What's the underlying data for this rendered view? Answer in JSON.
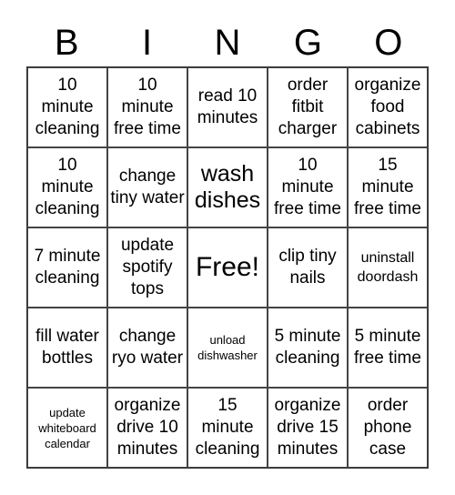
{
  "header": [
    "B",
    "I",
    "N",
    "G",
    "O"
  ],
  "cells": [
    "10 minute cleaning",
    "10 minute free time",
    "read 10 minutes",
    "order fitbit charger",
    "organize food cabinets",
    "10 minute cleaning",
    "change tiny water",
    "wash dishes",
    "10 minute free time",
    "15 minute free time",
    "7 minute cleaning",
    "update spotify tops",
    "Free!",
    "clip tiny nails",
    "uninstall doordash",
    "fill water bottles",
    "change ryo water",
    "unload dishwasher",
    "5 minute cleaning",
    "5 minute free time",
    "update whiteboard calendar",
    "organize drive 10 minutes",
    "15 minute cleaning",
    "organize drive 15 minutes",
    "order phone case"
  ]
}
